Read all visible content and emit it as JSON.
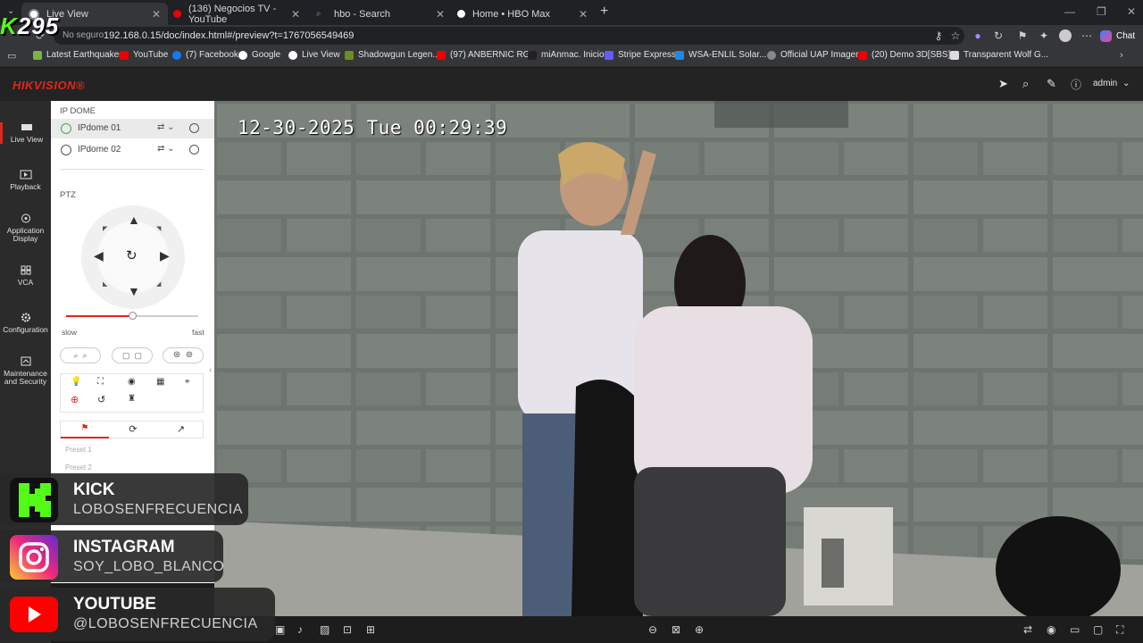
{
  "browser": {
    "tabs": [
      {
        "label": "Live View",
        "active": true
      },
      {
        "label": "(136) Negocios TV - YouTube",
        "active": false
      },
      {
        "label": "hbo - Search",
        "active": false
      },
      {
        "label": "Home • HBO Max",
        "active": false
      }
    ],
    "security_label": "No seguro",
    "url": "192.168.0.15/doc/index.html#/preview?t=1767056549469",
    "chat_label": "Chat",
    "bookmarks": [
      "Latest Earthquakes",
      "YouTube",
      "(7) Facebook",
      "Google",
      "Live View",
      "Shadowgun Legen...",
      "(97) ANBERNIC RG...",
      "miAnmac. Inicio",
      "Stripe Express",
      "WSA-ENLIL Solar...",
      "Official UAP Imagery",
      "(20) Demo 3D[SBS]...",
      "Transparent Wolf G..."
    ]
  },
  "header": {
    "brand": "HIKVISION®",
    "user": "admin"
  },
  "nav": {
    "items": [
      {
        "label": "Live View",
        "icon": "live-view-icon"
      },
      {
        "label": "Playback",
        "icon": "playback-icon"
      },
      {
        "label": "Application Display",
        "icon": "application-icon"
      },
      {
        "label": "VCA",
        "icon": "vca-icon"
      },
      {
        "label": "Configuration",
        "icon": "gear-icon"
      },
      {
        "label": "Maintenance and Security",
        "icon": "maintenance-icon"
      }
    ]
  },
  "panel": {
    "group_title": "IP DOME",
    "cameras": [
      "IPdome 01",
      "IPdome 02"
    ],
    "ptz_title": "PTZ",
    "speed_slow": "slow",
    "speed_fast": "fast",
    "speed_value": 0.5,
    "presets": [
      "Preset 1",
      "Preset 2"
    ]
  },
  "video": {
    "osd": "12-30-2025 Tue 00:29:39"
  },
  "overlay": {
    "logo_prefix": "K",
    "logo_num": "295",
    "socials": [
      {
        "title": "KICK",
        "handle": "LOBOSENFRECUENCIA",
        "color": "#53fc18"
      },
      {
        "title": "INSTAGRAM",
        "handle": "SOY_LOBO_BLANCO",
        "color": "#d62976"
      },
      {
        "title": "YOUTUBE",
        "handle": "@LOBOSENFRECUENCIA",
        "color": "#ff0000"
      }
    ]
  },
  "colors": {
    "accent": "#e1261c"
  }
}
